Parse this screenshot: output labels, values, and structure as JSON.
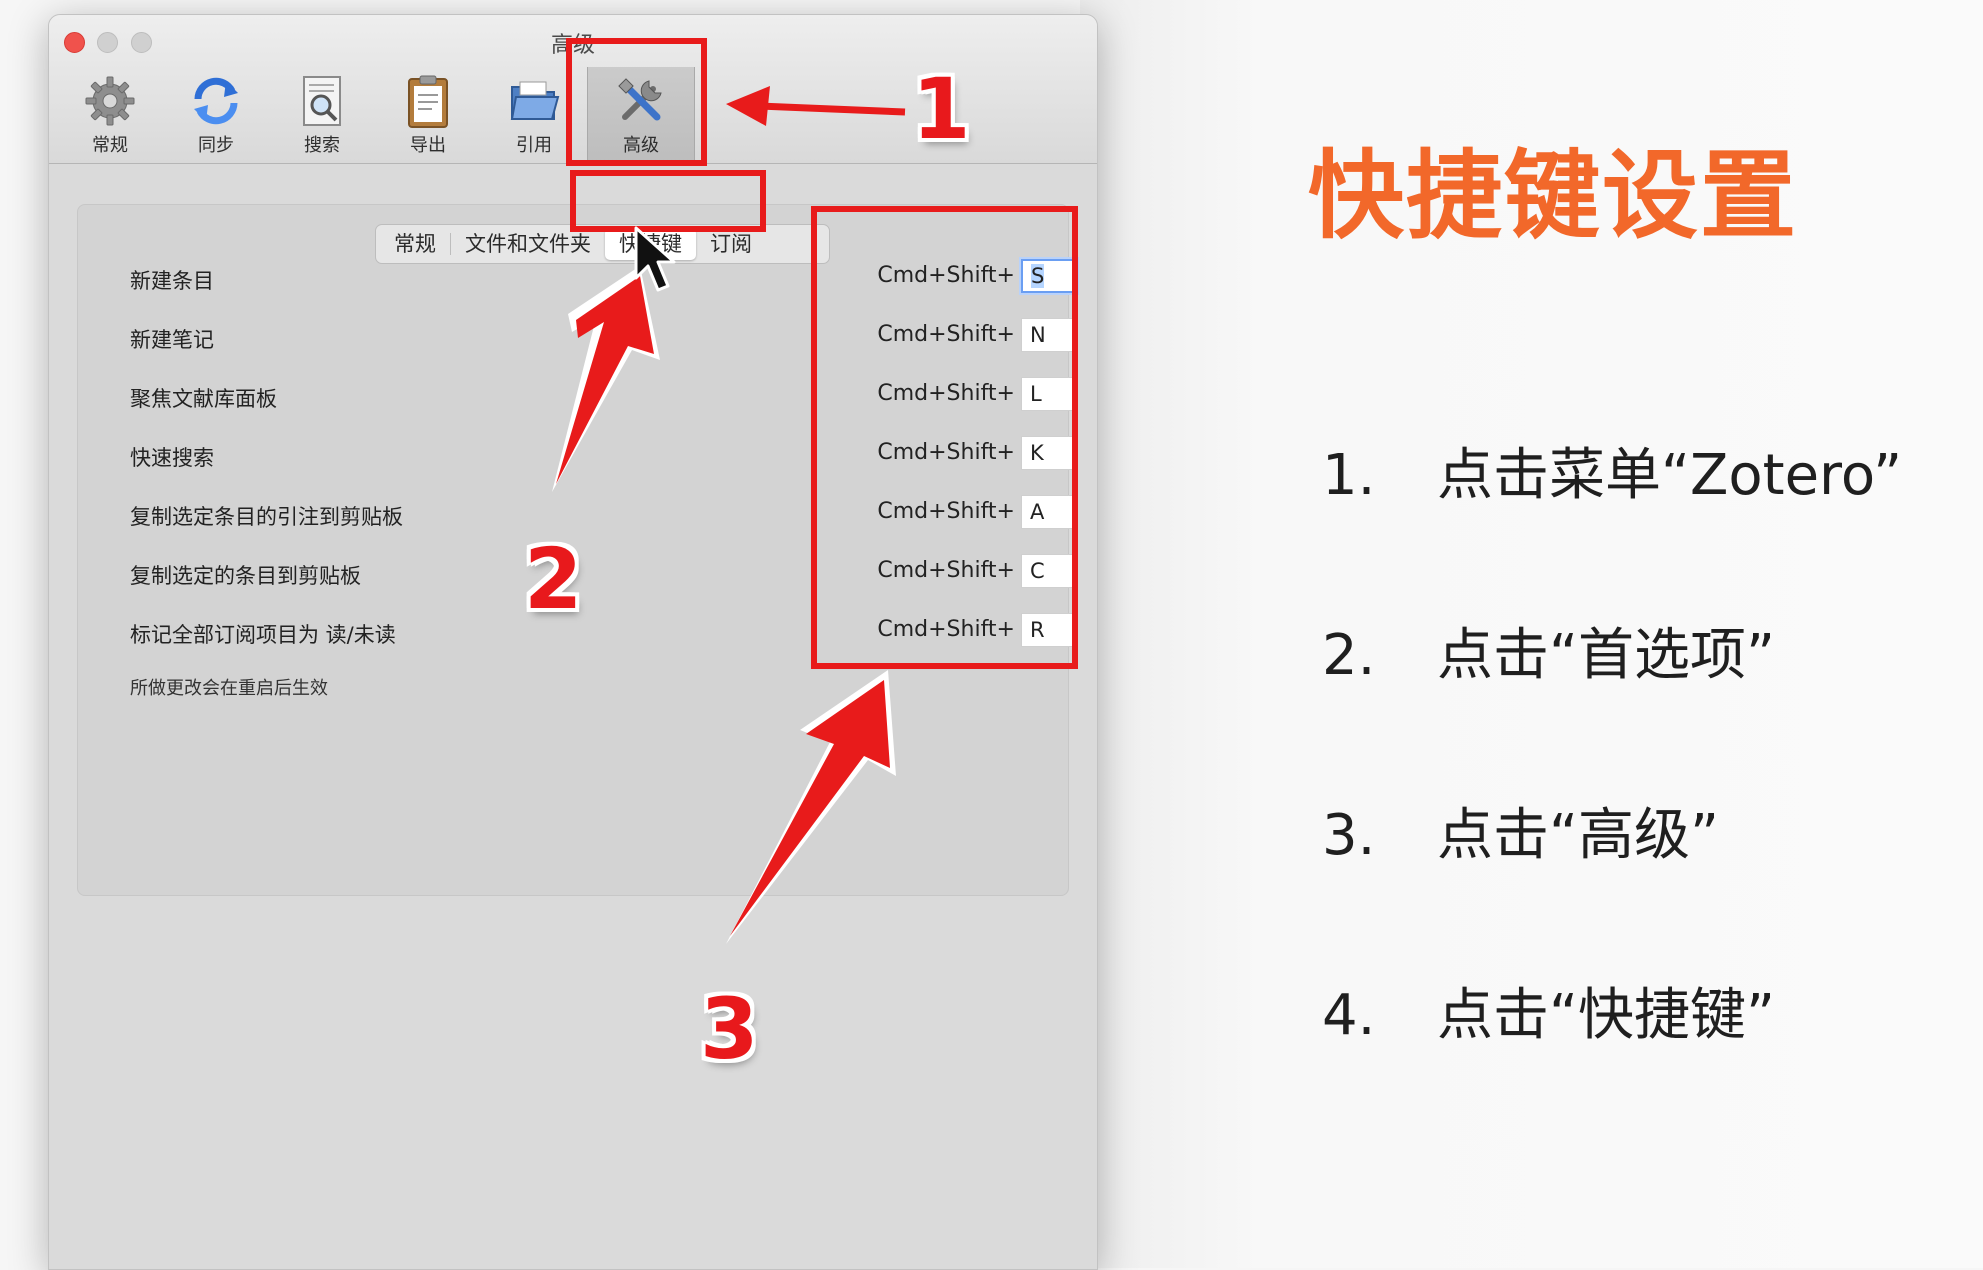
{
  "window": {
    "title": "高级",
    "toolbar": [
      {
        "label": "常规",
        "icon": "gear-icon"
      },
      {
        "label": "同步",
        "icon": "sync-icon"
      },
      {
        "label": "搜索",
        "icon": "search-doc-icon"
      },
      {
        "label": "导出",
        "icon": "clipboard-icon"
      },
      {
        "label": "引用",
        "icon": "folder-icon"
      },
      {
        "label": "高级",
        "icon": "tools-icon",
        "active": true
      }
    ],
    "tabs": [
      "常规",
      "文件和文件夹",
      "快捷键",
      "订阅"
    ],
    "active_tab": "快捷键",
    "shortcuts": [
      {
        "label": "新建条目",
        "prefix": "Cmd+Shift+",
        "key": "S"
      },
      {
        "label": "新建笔记",
        "prefix": "Cmd+Shift+",
        "key": "N"
      },
      {
        "label": "聚焦文献库面板",
        "prefix": "Cmd+Shift+",
        "key": "L"
      },
      {
        "label": "快速搜索",
        "prefix": "Cmd+Shift+",
        "key": "K"
      },
      {
        "label": "复制选定条目的引注到剪贴板",
        "prefix": "Cmd+Shift+",
        "key": "A"
      },
      {
        "label": "复制选定的条目到剪贴板",
        "prefix": "Cmd+Shift+",
        "key": "C"
      },
      {
        "label": "标记全部订阅项目为 读/未读",
        "prefix": "Cmd+Shift+",
        "key": "R"
      }
    ],
    "note": "所做更改会在重启后生效"
  },
  "annotations": {
    "numbers": [
      "1",
      "2",
      "3"
    ],
    "color": "#e8191c"
  },
  "guide": {
    "heading": "快捷键设置",
    "heading_color": "#f2682a",
    "steps": [
      {
        "num": "1.",
        "text": "点击菜单“Zotero”"
      },
      {
        "num": "2.",
        "text": "点击“首选项”"
      },
      {
        "num": "3.",
        "text": "点击“高级”"
      },
      {
        "num": "4.",
        "text": "点击“快捷键”"
      }
    ]
  }
}
